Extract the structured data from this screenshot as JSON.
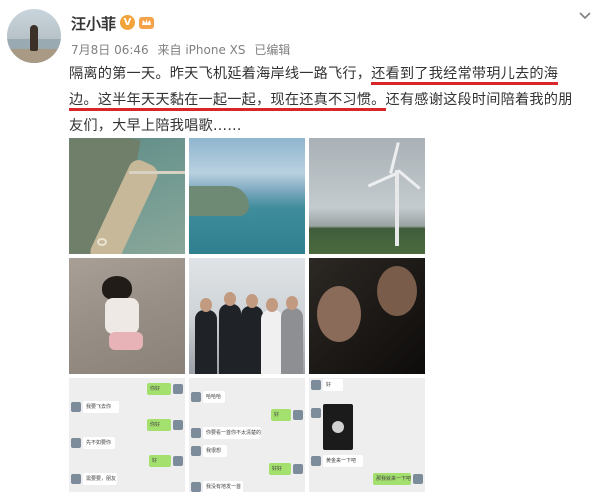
{
  "post": {
    "author": "汪小菲",
    "verified_badge": "V",
    "meta": {
      "date": "7月8日 06:46",
      "source": "来自 iPhone XS",
      "edited": "已编辑"
    },
    "text_lines": [
      "隔离的第一天。昨天飞机延着海岸线一路飞行，",
      "还看到了我经常带玥儿去的海",
      "边。这半年天天黏在一起一起，现在还真不习惯。",
      "还有感谢这段时间陪着我的朋",
      "友们，大早上陪我唱歌……"
    ]
  },
  "images": {
    "chat1": {
      "msg1": "你好",
      "msg2": "我要飞去你",
      "msg3": "你好",
      "msg4": "先不如要你",
      "msg5": "好",
      "msg6": "需要要，朋友"
    },
    "chat2": {
      "msg1": "哈哈哈",
      "msg2": "好",
      "msg3": "你要看一首你不太清楚的",
      "msg4": "我很想",
      "msg5": "好好",
      "msg6": "我没有地发一首"
    },
    "chat3": {
      "msg1": "好",
      "msg2": "黄金来一下吧",
      "msg3": "那我就来一下吧"
    }
  },
  "colors": {
    "highlight": "#d9262b",
    "badge": "#f2a33a",
    "meta_text": "#808080"
  },
  "icons": [
    "crown-icon",
    "chevron-down-icon",
    "verified-badge-icon"
  ]
}
